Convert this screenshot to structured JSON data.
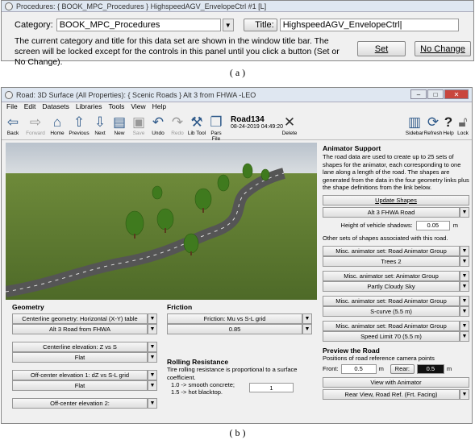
{
  "caption_a": "( a )",
  "caption_b": "( b )",
  "panel_a": {
    "window_title": "Procedures:  { BOOK_MPC_Procedures }  HighspeedAGV_EnvelopeCtrl #1 [L]",
    "category_label": "Category:",
    "category_value": "BOOK_MPC_Procedures",
    "title_label": "Title:",
    "title_value": "HighspeedAGV_EnvelopeCtrl",
    "description": "The current category and title for this data set are shown in the window title bar. The screen will be locked except for the controls in this panel until you click a button (Set or No Change).",
    "set_button": "Set",
    "no_change_button": "No Change"
  },
  "panel_b": {
    "window_title": "Road: 3D Surface (All Properties):  { Scenic Roads }  Alt 3 from FHWA -LEO",
    "menu": [
      "File",
      "Edit",
      "Datasets",
      "Libraries",
      "Tools",
      "View",
      "Help"
    ],
    "toolbar": {
      "back": "Back",
      "forward": "Forward",
      "home": "Home",
      "previous": "Previous",
      "next": "Next",
      "new": "New",
      "save": "Save",
      "undo": "Undo",
      "redo": "Redo",
      "lib_tool": "Lib Tool",
      "pars_file": "Pars File",
      "delete": "Delete",
      "sidebar": "Sidebar",
      "refresh": "Refresh",
      "help": "Help",
      "lock": "Lock"
    },
    "dataset_name": "Road134",
    "dataset_date": "08-24-2019 04:49:20",
    "animator": {
      "title": "Animator Support",
      "description": "The road data are used to create up to 25 sets of shapes for the animator, each corresponding to one lane along a length of the road. The shapes are generated from the data in the four geometry links plus the shape definitions from the link below.",
      "update_shapes": "Update Shapes",
      "shape_link": "Alt 3 FHWA Road",
      "shadow_label": "Height of vehicle shadows:",
      "shadow_value": "0.05",
      "shadow_unit": "m",
      "other_sets": "Other sets of shapes associated with this road.",
      "groups": [
        {
          "header": "Misc. animator set: Road Animator Group",
          "value": "Trees 2"
        },
        {
          "header": "Misc. animator set: Animator Group",
          "value": "Partly Cloudy Sky"
        },
        {
          "header": "Misc. animator set: Road Animator Group",
          "value": "S-curve (5.5 m)"
        },
        {
          "header": "Misc. animator set: Road Animator Group",
          "value": "Speed Limit 70 (5.5 m)"
        }
      ]
    },
    "preview": {
      "title": "Preview the Road",
      "desc": "Positions of road reference camera points",
      "front_label": "Front:",
      "front_value": "0.5",
      "rear_label": "Rear:",
      "rear_value": "0.5",
      "unit": "m",
      "view_button": "View with Animator",
      "view_select": "Rear View, Road Ref. (Frt. Facing)"
    },
    "geometry": {
      "title": "Geometry",
      "centerline_geom": "Centerline geometry: Horizontal (X-Y) table",
      "centerline_geom_value": "Alt 3 Road from FHWA",
      "centerline_elev": "Centerline elevation: Z vs S",
      "centerline_elev_value": "Flat",
      "offcenter1": "Off-center elevation 1: dZ vs S-L grid",
      "offcenter1_value": "Flat",
      "offcenter2": "Off-center elevation 2:"
    },
    "friction": {
      "title": "Friction",
      "select": "Friction: Mu vs S-L grid",
      "value": "0.85"
    },
    "rolling": {
      "title": "Rolling Resistance",
      "desc": "Tire rolling resistance is proportional to a surface coefficient.",
      "line1": "1.0 -> smooth concrete;",
      "line2": "1.5 -> hot blacktop.",
      "value": "1"
    }
  }
}
